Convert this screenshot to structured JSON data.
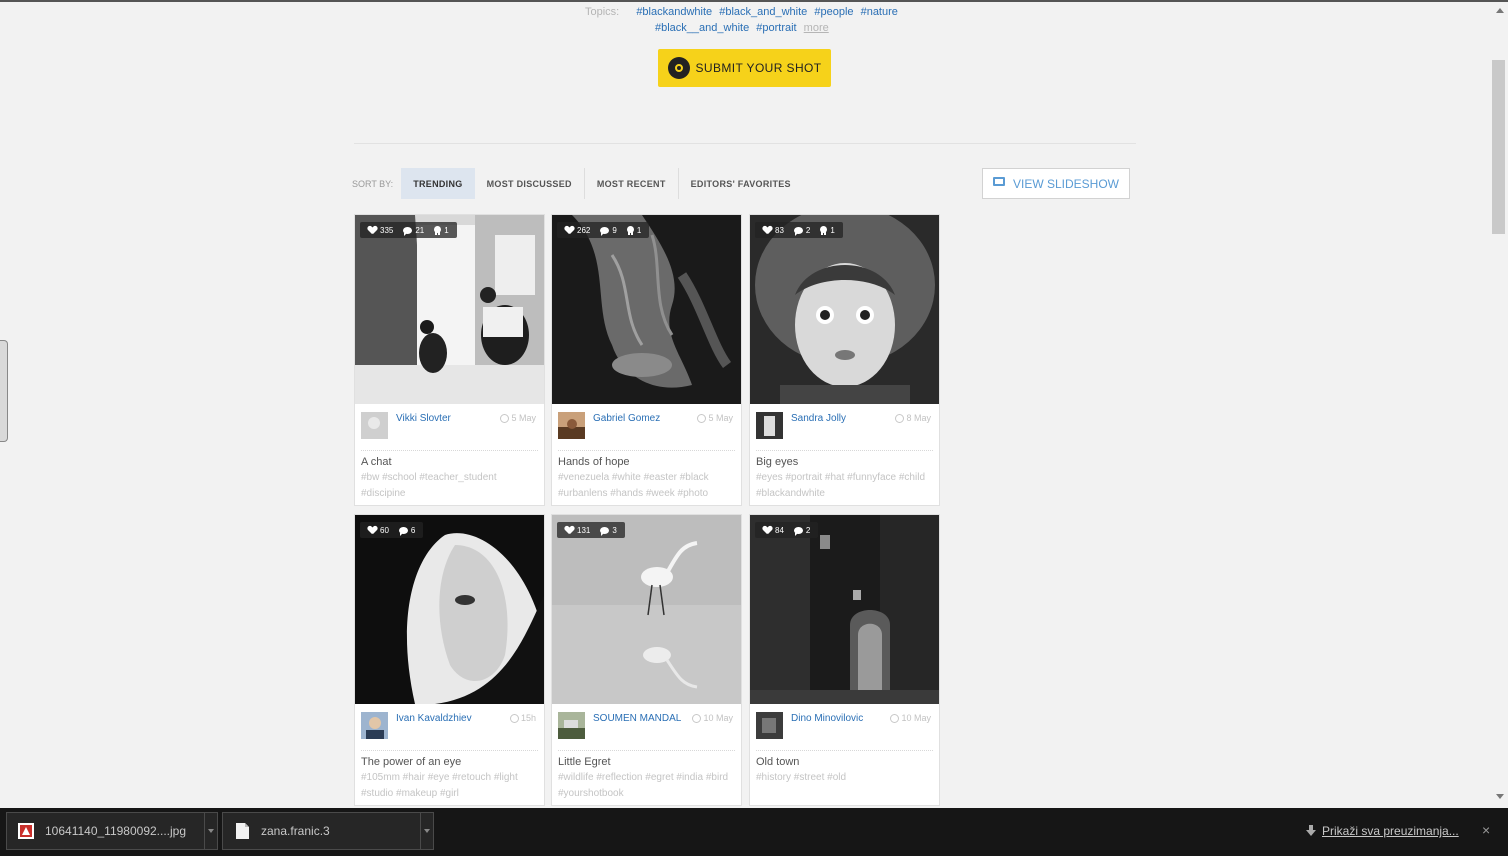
{
  "topics": {
    "label": "Topics:",
    "tags": [
      "#blackandwhite",
      "#black_and_white",
      "#people",
      "#nature",
      "#black__and_white",
      "#portrait"
    ],
    "more": "more"
  },
  "submit_label": "SUBMIT YOUR SHOT",
  "sort": {
    "label": "SORT BY:",
    "tabs": [
      "TRENDING",
      "MOST DISCUSSED",
      "MOST RECENT",
      "EDITORS' FAVORITES"
    ],
    "active": "TRENDING"
  },
  "slideshow_label": "VIEW SLIDESHOW",
  "cards": [
    {
      "likes": "335",
      "comments": "21",
      "awards": "1",
      "author": "Vikki Slovter",
      "date": "5 May",
      "title": "A chat",
      "tags": "#bw #school #teacher_student #discipine"
    },
    {
      "likes": "262",
      "comments": "9",
      "awards": "1",
      "author": "Gabriel Gomez",
      "date": "5 May",
      "title": "Hands of hope",
      "tags": "#venezuela #white #easter #black #urbanlens #hands #week #photo"
    },
    {
      "likes": "83",
      "comments": "2",
      "awards": "1",
      "author": "Sandra Jolly",
      "date": "8 May",
      "title": "Big eyes",
      "tags": "#eyes #portrait #hat #funnyface #child #blackandwhite"
    },
    {
      "likes": "60",
      "comments": "6",
      "awards": "",
      "author": "Ivan Kavaldzhiev",
      "date": "15h",
      "title": "The power of an eye",
      "tags": "#105mm #hair #eye #retouch #light #studio #makeup #girl"
    },
    {
      "likes": "131",
      "comments": "3",
      "awards": "",
      "author": "SOUMEN MANDAL",
      "date": "10 May",
      "title": "Little Egret",
      "tags": "#wildlife #reflection #egret #india #bird #yourshotbook"
    },
    {
      "likes": "84",
      "comments": "2",
      "awards": "",
      "author": "Dino Minovilovic",
      "date": "10 May",
      "title": "Old town",
      "tags": "#history #street #old"
    }
  ],
  "downloads": [
    {
      "name": "10641140_11980092....jpg",
      "icon": "image-file-icon"
    },
    {
      "name": "zana.franic.3",
      "icon": "document-file-icon"
    }
  ],
  "download_show_all": "Prikaži sva preuzimanja...",
  "download_close": "×",
  "colors": {
    "accent": "#f6d21a",
    "link": "#2a6fb5",
    "active_tab": "#dde5ef"
  }
}
